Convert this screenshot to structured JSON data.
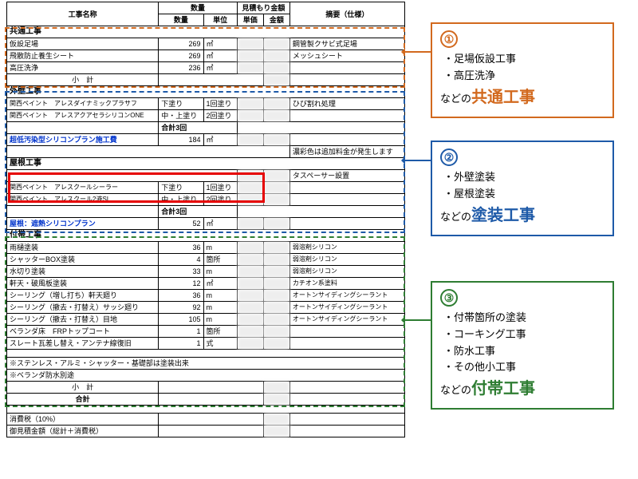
{
  "headers": {
    "name": "工事名称",
    "qty_group": "数量",
    "qty": "数量",
    "unit": "単位",
    "est_group": "見積もり金額",
    "unitprice": "単価",
    "amount": "金額",
    "remark": "摘要（仕様）"
  },
  "sections": {
    "common": {
      "title": "共通工事",
      "rows": [
        {
          "name": "仮設足場",
          "qty": "269",
          "unit": "㎡",
          "remark": "鋼管製クサビ式足場"
        },
        {
          "name": "飛散防止養生シート",
          "qty": "269",
          "unit": "㎡",
          "remark": "メッシュシート"
        },
        {
          "name": "高圧洗浄",
          "qty": "236",
          "unit": "㎡",
          "remark": ""
        }
      ],
      "subtotal": "小　計"
    },
    "ext": {
      "title": "外壁工事",
      "rows": [
        {
          "name": "関西ペイント　アレスダイナミックプラサフ",
          "coat": "下塗り",
          "times": "1回塗り",
          "remark": "ひび割れ処理"
        },
        {
          "name": "関西ペイント　アレスアクアセラシリコンONE",
          "coat": "中・上塗り",
          "times": "2回塗り",
          "remark": ""
        }
      ],
      "sum_label": "合計3回",
      "plan": {
        "name": "超低汚染型シリコンプラン施工費",
        "qty": "184",
        "unit": "㎡"
      },
      "note": "濃彩色は追加料金が発生します"
    },
    "roof": {
      "title": "屋根工事",
      "note_top": "タスペーサー設置",
      "rows": [
        {
          "name": "関西ペイント　アレスクールシーラー",
          "coat": "下塗り",
          "times": "1回塗り"
        },
        {
          "name": "関西ペイント　アレスクール2液SI",
          "coat": "中・上塗り",
          "times": "2回塗り"
        }
      ],
      "sum_label": "合計3回",
      "plan": {
        "name": "屋根：遮熱シリコンプラン",
        "qty": "52",
        "unit": "㎡"
      }
    },
    "anc": {
      "title": "付帯工事",
      "rows": [
        {
          "name": "雨樋塗装",
          "qty": "36",
          "unit": "m",
          "remark": "弱溶剤シリコン"
        },
        {
          "name": "シャッターBOX塗装",
          "qty": "4",
          "unit": "箇所",
          "remark": "弱溶剤シリコン"
        },
        {
          "name": "水切り塗装",
          "qty": "33",
          "unit": "m",
          "remark": "弱溶剤シリコン"
        },
        {
          "name": "軒天・破風板塗装",
          "qty": "12",
          "unit": "㎡",
          "remark": "カチオン系塗料"
        },
        {
          "name": "シーリング（増し打ち）軒天廻り",
          "qty": "36",
          "unit": "m",
          "remark": "オートンサイディングシーラント"
        },
        {
          "name": "シーリング（撤去・打替え）サッシ廻り",
          "qty": "92",
          "unit": "m",
          "remark": "オートンサイディングシーラント"
        },
        {
          "name": "シーリング（撤去・打替え）目地",
          "qty": "105",
          "unit": "m",
          "remark": "オートンサイディングシーラント"
        },
        {
          "name": "ベランダ床　FRPトップコート",
          "qty": "1",
          "unit": "箇所",
          "remark": ""
        },
        {
          "name": "スレート瓦差し替え・アンテナ線復旧",
          "qty": "1",
          "unit": "式",
          "remark": ""
        }
      ],
      "notes": [
        "※ステンレス・アルミ・シャッター・基礎部は塗装出来",
        "※ベランダ防水別途"
      ],
      "subtotal": "小　計"
    }
  },
  "totals": {
    "sum": "合計",
    "tax": "消費税（10%）",
    "grand": "御見積金額（総計＋消費税）"
  },
  "callouts": {
    "c1": {
      "num": "①",
      "items": [
        "足場仮設工事",
        "高圧洗浄"
      ],
      "prefix": "などの",
      "big": "共通工事"
    },
    "c2": {
      "num": "②",
      "items": [
        "外壁塗装",
        "屋根塗装"
      ],
      "prefix": "などの",
      "big": "塗装工事"
    },
    "c3": {
      "num": "③",
      "items": [
        "付帯箇所の塗装",
        "コーキング工事",
        "防水工事",
        "その他小工事"
      ],
      "prefix": "などの",
      "big": "付帯工事"
    }
  }
}
